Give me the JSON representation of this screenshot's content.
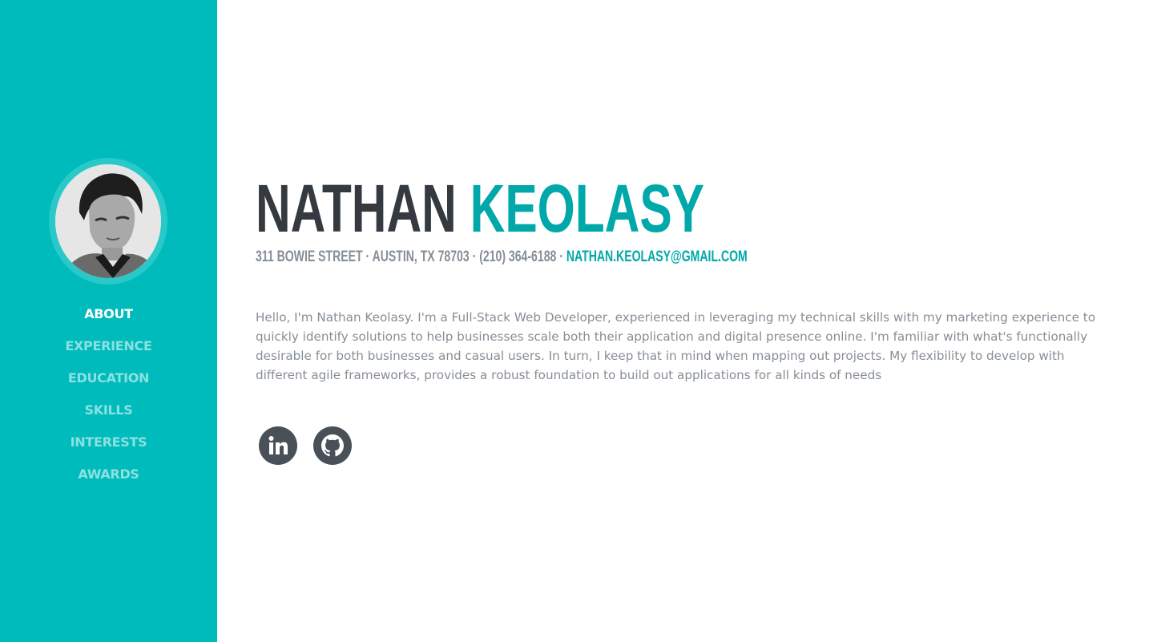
{
  "sidebar": {
    "avatar_alt": "profile photo",
    "nav": [
      {
        "label": "ABOUT",
        "active": true
      },
      {
        "label": "EXPERIENCE",
        "active": false
      },
      {
        "label": "EDUCATION",
        "active": false
      },
      {
        "label": "SKILLS",
        "active": false
      },
      {
        "label": "INTERESTS",
        "active": false
      },
      {
        "label": "AWARDS",
        "active": false
      }
    ]
  },
  "about": {
    "first_name": "NATHAN",
    "last_name": "KEOLASY",
    "address": "311 BOWIE STREET · AUSTIN, TX 78703 · (210) 364-6188 · ",
    "email": "NATHAN.KEOLASY@GMAIL.COM",
    "bio": "Hello, I'm Nathan Keolasy. I'm a Full-Stack Web Developer, experienced in leveraging my technical skills with my marketing experience to quickly identify solutions to help businesses scale both their application and digital presence online. I'm familiar with what's functionally desirable for both businesses and casual users. In turn, I keep that in mind when mapping out projects. My flexibility to develop with different agile frameworks, provides a robust foundation to build out applications for all kinds of needs"
  },
  "social": [
    {
      "icon": "linkedin-icon"
    },
    {
      "icon": "github-icon"
    }
  ],
  "colors": {
    "sidebar_bg": "#00bbbc",
    "accent": "#00a8a9",
    "dark": "#343a40",
    "muted": "#868e96",
    "social_bg": "#495057"
  }
}
